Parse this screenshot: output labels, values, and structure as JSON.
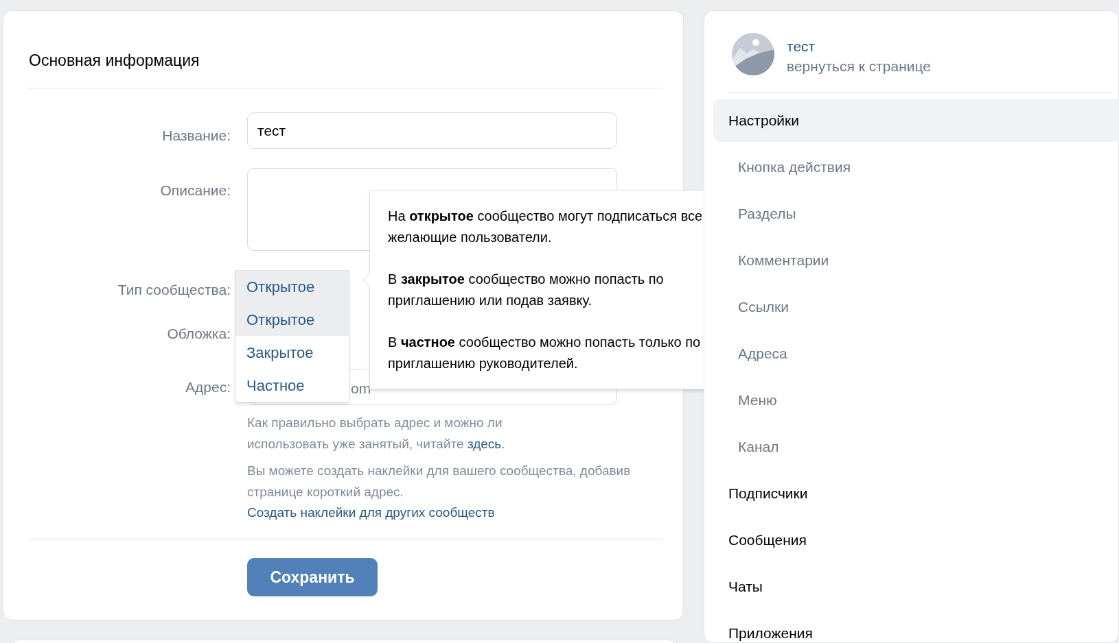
{
  "main_card": {
    "title": "Основная информация",
    "fields": [
      {
        "kind": "input",
        "label": "Название:",
        "value": "тест"
      },
      {
        "kind": "textarea",
        "label": "Описание:"
      },
      {
        "kind": "select",
        "label": "Тип сообщества:"
      },
      {
        "kind": "none",
        "label": "Обложка:"
      },
      {
        "kind": "address",
        "label": "Адрес:",
        "value": "om"
      }
    ],
    "dropdown": {
      "current": "Открытое",
      "options": [
        {
          "label": "Открытое",
          "selected": true
        },
        {
          "label": "Закрытое",
          "selected": false
        },
        {
          "label": "Частное",
          "selected": false
        }
      ]
    },
    "tooltip": [
      "На **открытое** сообщество могут подписаться все желающие пользователи.",
      "В **закрытое** сообщество можно попасть по приглашению или подав заявку.",
      "В **частное** сообщество можно попасть только по приглашению руководителей."
    ],
    "address_help": {
      "text": "Как правильно выбрать адрес и можно ли использовать уже занятый, читайте",
      "link": "здесь",
      "end": "."
    },
    "stickers_help": "Вы можете создать наклейки для вашего сообщества, добавив странице короткий адрес.",
    "stickers_link": "Создать наклейки для других сообществ",
    "save_button": "Сохранить"
  },
  "sidebar": {
    "name": "тест",
    "back_link": "вернуться к странице",
    "items": [
      {
        "label": "Настройки",
        "selected": true,
        "children": [
          {
            "label": "Кнопка действия",
            "selected": false
          },
          {
            "label": "Разделы",
            "selected": false
          },
          {
            "label": "Комментарии",
            "selected": false
          },
          {
            "label": "Ссылки",
            "selected": false
          },
          {
            "label": "Адреса",
            "selected": false
          },
          {
            "label": "Меню",
            "selected": false
          },
          {
            "label": "Канал",
            "selected": false
          }
        ]
      },
      {
        "label": "Подписчики",
        "selected": false
      },
      {
        "label": "Сообщения",
        "selected": false
      },
      {
        "label": "Чаты",
        "selected": false
      },
      {
        "label": "Приложения",
        "selected": false
      }
    ]
  }
}
